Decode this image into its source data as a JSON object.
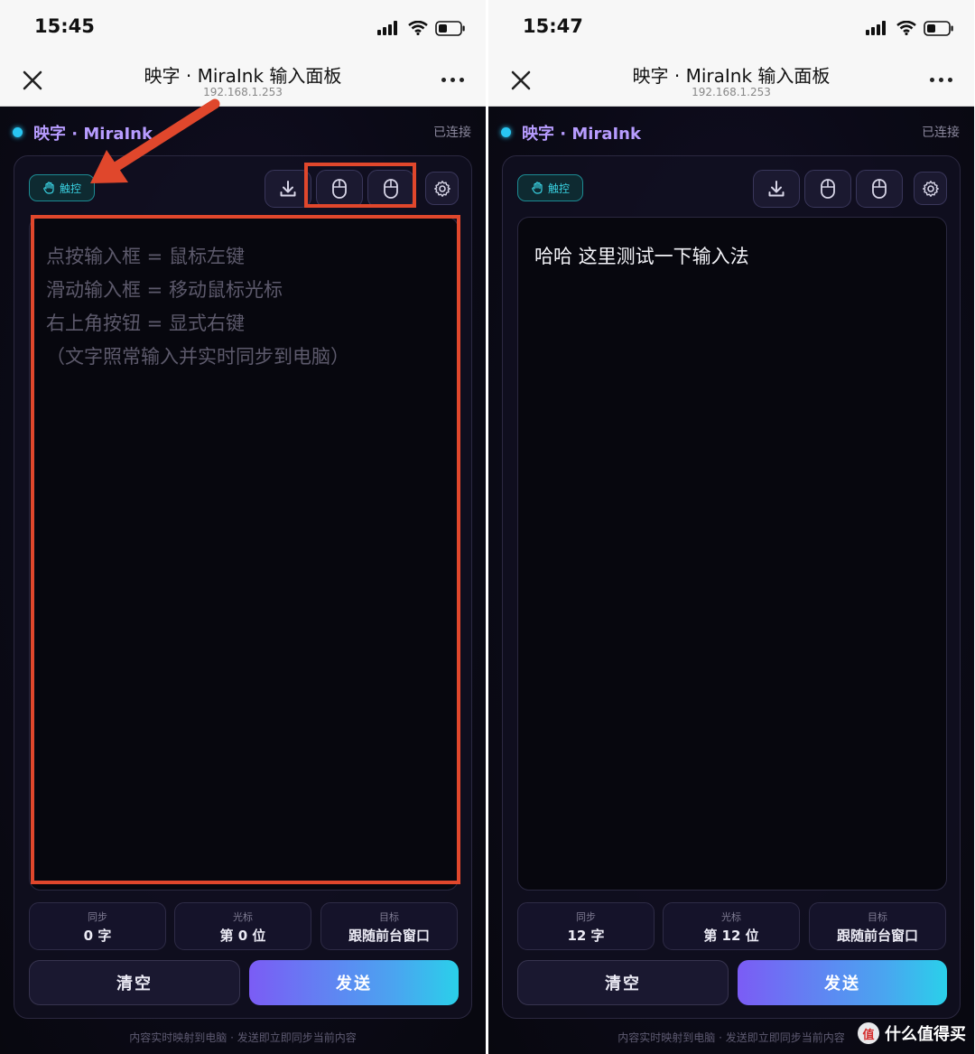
{
  "browser": {
    "title": "映字 · MiraInk 输入面板",
    "url": "192.168.1.253"
  },
  "app": {
    "brand": "映字 · MiraInk",
    "connection_status": "已连接",
    "touch_label": "触控",
    "placeholder_lines": [
      "点按输入框 = 鼠标左键",
      "滑动输入框 = 移动鼠标光标",
      "右上角按钮 = 显式右键",
      "（文字照常输入并实时同步到电脑）"
    ],
    "stat_labels": {
      "sync": "同步",
      "cursor": "光标",
      "target": "目标"
    },
    "clear_label": "清空",
    "send_label": "发送",
    "footnote": "内容实时映射到电脑 · 发送即立即同步当前内容",
    "colors": {
      "accent_purple": "#b79cff",
      "status_dot": "#29c6f2",
      "annotation_red": "#e0472c"
    }
  },
  "screens": [
    {
      "time": "15:45",
      "editor_text": "",
      "stats": {
        "sync": "0 字",
        "cursor": "第 0 位",
        "target": "跟随前台窗口"
      }
    },
    {
      "time": "15:47",
      "editor_text": "哈哈 这里测试一下输入法",
      "stats": {
        "sync": "12 字",
        "cursor": "第 12 位",
        "target": "跟随前台窗口"
      }
    }
  ],
  "icons": [
    "close-icon",
    "more-icon",
    "signal-icon",
    "wifi-icon",
    "battery-icon",
    "hand-icon",
    "download-icon",
    "mouse-icon",
    "gear-icon"
  ],
  "watermark": {
    "text": "什么值得买",
    "logo": "值"
  }
}
